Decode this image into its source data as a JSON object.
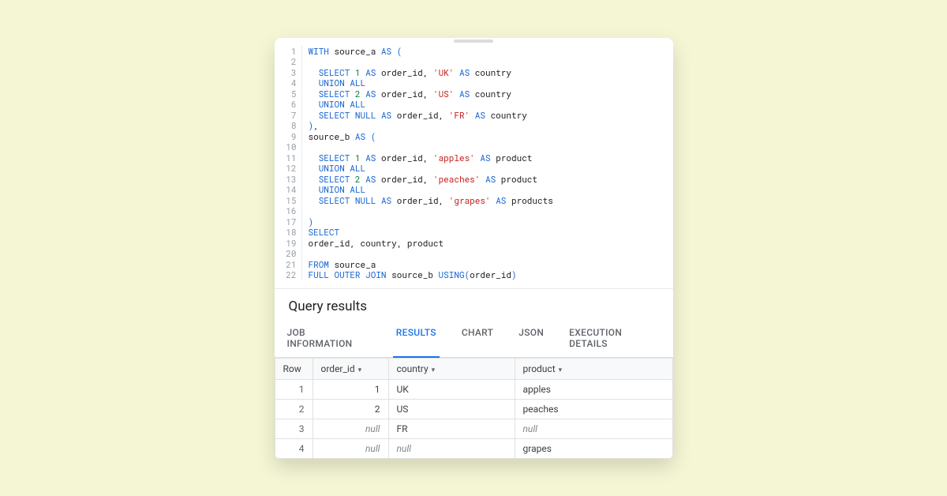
{
  "editor": {
    "lines": [
      [
        {
          "cls": "kw",
          "t": "WITH"
        },
        {
          "t": " source_a "
        },
        {
          "cls": "kw",
          "t": "AS"
        },
        {
          "t": " "
        },
        {
          "cls": "pn",
          "t": "("
        }
      ],
      [],
      [
        {
          "t": "  "
        },
        {
          "cls": "kw",
          "t": "SELECT"
        },
        {
          "t": " "
        },
        {
          "cls": "num",
          "t": "1"
        },
        {
          "t": " "
        },
        {
          "cls": "kw",
          "t": "AS"
        },
        {
          "t": " order_id, "
        },
        {
          "cls": "str",
          "t": "'UK'"
        },
        {
          "t": " "
        },
        {
          "cls": "kw",
          "t": "AS"
        },
        {
          "t": " country"
        }
      ],
      [
        {
          "t": "  "
        },
        {
          "cls": "kw",
          "t": "UNION ALL"
        }
      ],
      [
        {
          "t": "  "
        },
        {
          "cls": "kw",
          "t": "SELECT"
        },
        {
          "t": " "
        },
        {
          "cls": "num",
          "t": "2"
        },
        {
          "t": " "
        },
        {
          "cls": "kw",
          "t": "AS"
        },
        {
          "t": " order_id, "
        },
        {
          "cls": "str",
          "t": "'US'"
        },
        {
          "t": " "
        },
        {
          "cls": "kw",
          "t": "AS"
        },
        {
          "t": " country"
        }
      ],
      [
        {
          "t": "  "
        },
        {
          "cls": "kw",
          "t": "UNION ALL"
        }
      ],
      [
        {
          "t": "  "
        },
        {
          "cls": "kw",
          "t": "SELECT"
        },
        {
          "t": " "
        },
        {
          "cls": "kw",
          "t": "NULL"
        },
        {
          "t": " "
        },
        {
          "cls": "kw",
          "t": "AS"
        },
        {
          "t": " order_id, "
        },
        {
          "cls": "str",
          "t": "'FR'"
        },
        {
          "t": " "
        },
        {
          "cls": "kw",
          "t": "AS"
        },
        {
          "t": " country"
        }
      ],
      [
        {
          "cls": "pn",
          "t": ")"
        },
        {
          "t": ","
        }
      ],
      [
        {
          "t": "source_b "
        },
        {
          "cls": "kw",
          "t": "AS"
        },
        {
          "t": " "
        },
        {
          "cls": "pn",
          "t": "("
        }
      ],
      [],
      [
        {
          "t": "  "
        },
        {
          "cls": "kw",
          "t": "SELECT"
        },
        {
          "t": " "
        },
        {
          "cls": "num",
          "t": "1"
        },
        {
          "t": " "
        },
        {
          "cls": "kw",
          "t": "AS"
        },
        {
          "t": " order_id, "
        },
        {
          "cls": "str",
          "t": "'apples'"
        },
        {
          "t": " "
        },
        {
          "cls": "kw",
          "t": "AS"
        },
        {
          "t": " product"
        }
      ],
      [
        {
          "t": "  "
        },
        {
          "cls": "kw",
          "t": "UNION ALL"
        }
      ],
      [
        {
          "t": "  "
        },
        {
          "cls": "kw",
          "t": "SELECT"
        },
        {
          "t": " "
        },
        {
          "cls": "num",
          "t": "2"
        },
        {
          "t": " "
        },
        {
          "cls": "kw",
          "t": "AS"
        },
        {
          "t": " order_id, "
        },
        {
          "cls": "str",
          "t": "'peaches'"
        },
        {
          "t": " "
        },
        {
          "cls": "kw",
          "t": "AS"
        },
        {
          "t": " product"
        }
      ],
      [
        {
          "t": "  "
        },
        {
          "cls": "kw",
          "t": "UNION ALL"
        }
      ],
      [
        {
          "t": "  "
        },
        {
          "cls": "kw",
          "t": "SELECT"
        },
        {
          "t": " "
        },
        {
          "cls": "kw",
          "t": "NULL"
        },
        {
          "t": " "
        },
        {
          "cls": "kw",
          "t": "AS"
        },
        {
          "t": " order_id, "
        },
        {
          "cls": "str",
          "t": "'grapes'"
        },
        {
          "t": " "
        },
        {
          "cls": "kw",
          "t": "AS"
        },
        {
          "t": " products"
        }
      ],
      [],
      [
        {
          "cls": "pn",
          "t": ")"
        }
      ],
      [
        {
          "cls": "kw",
          "t": "SELECT"
        }
      ],
      [
        {
          "t": "order_id, country, product"
        }
      ],
      [],
      [
        {
          "cls": "kw",
          "t": "FROM"
        },
        {
          "t": " source_a"
        }
      ],
      [
        {
          "cls": "kw",
          "t": "FULL OUTER JOIN"
        },
        {
          "t": " source_b "
        },
        {
          "cls": "fn",
          "t": "USING"
        },
        {
          "cls": "pn",
          "t": "("
        },
        {
          "t": "order_id"
        },
        {
          "cls": "pn",
          "t": ")"
        }
      ]
    ]
  },
  "results": {
    "title": "Query results",
    "tabs": [
      "JOB INFORMATION",
      "RESULTS",
      "CHART",
      "JSON",
      "EXECUTION DETAILS"
    ],
    "active_tab": 1,
    "columns": [
      "Row",
      "order_id",
      "country",
      "product"
    ],
    "rows": [
      {
        "row": "1",
        "order_id": "1",
        "country": "UK",
        "product": "apples"
      },
      {
        "row": "2",
        "order_id": "2",
        "country": "US",
        "product": "peaches"
      },
      {
        "row": "3",
        "order_id": null,
        "country": "FR",
        "product": null
      },
      {
        "row": "4",
        "order_id": null,
        "country": null,
        "product": "grapes"
      }
    ],
    "null_text": "null"
  }
}
